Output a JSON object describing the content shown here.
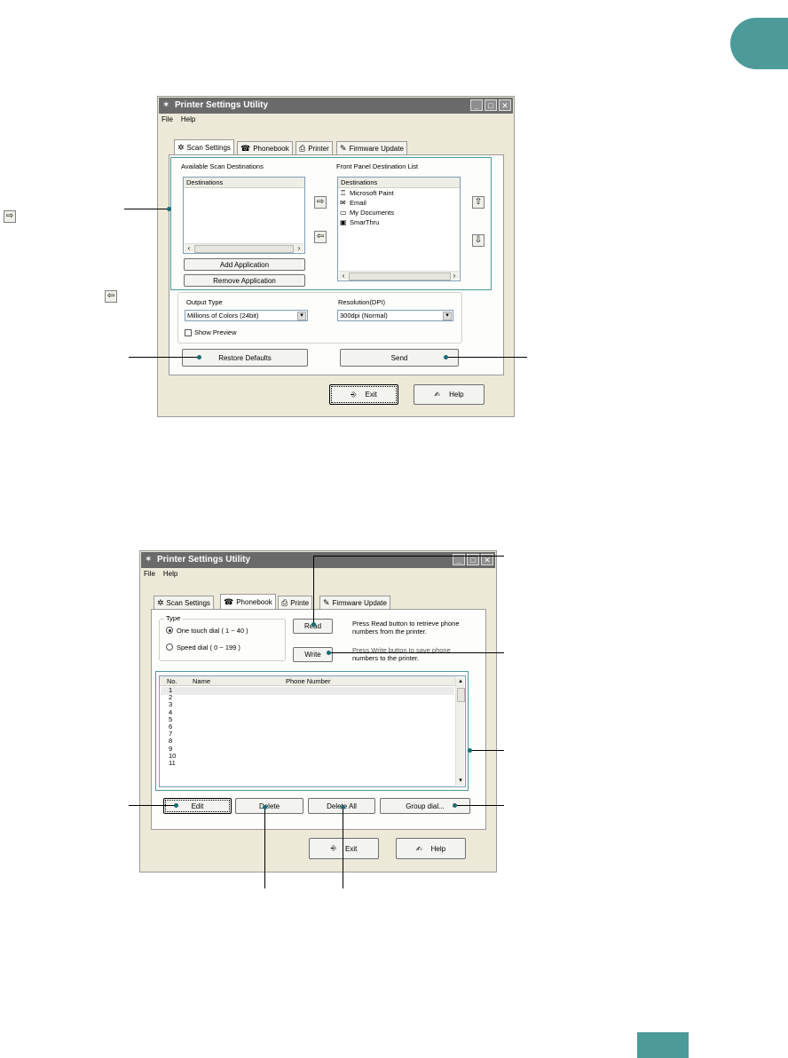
{
  "colors": {
    "accent": "#4d9a9b",
    "callout_dot": "#1a6b74"
  },
  "window1": {
    "title": "Printer Settings Utility",
    "menu": [
      "File",
      "Help"
    ],
    "tabs": [
      {
        "label": "Scan Settings",
        "icon": "scanner-icon"
      },
      {
        "label": "Phonebook",
        "icon": "phonebook-icon"
      },
      {
        "label": "Printer",
        "icon": "printer-icon"
      },
      {
        "label": "Firmware Update",
        "icon": "firmware-icon"
      }
    ],
    "available_label": "Available Scan Destinations",
    "front_panel_label": "Front Panel Destination List",
    "destinations_header": "Destinations",
    "front_panel_items": [
      {
        "label": "Microsoft Paint",
        "icon": "paint-icon"
      },
      {
        "label": "Email",
        "icon": "email-icon"
      },
      {
        "label": "My Documents",
        "icon": "folder-icon"
      },
      {
        "label": "SmarThru",
        "icon": "smarthru-icon"
      }
    ],
    "add_application": "Add Application",
    "remove_application": "Remove Application",
    "output_type_label": "Output Type",
    "output_type_value": "Millions of Colors (24bit)",
    "resolution_label": "Resolution(DPI)",
    "resolution_value": "300dpi (Normal)",
    "show_preview": "Show Preview",
    "restore_defaults": "Restore Defaults",
    "send": "Send",
    "exit": "Exit",
    "help": "Help"
  },
  "window2": {
    "title": "Printer Settings Utility",
    "menu": [
      "File",
      "Help"
    ],
    "tabs": [
      {
        "label": "Scan Settings",
        "icon": "scanner-icon"
      },
      {
        "label": "Phonebook",
        "icon": "phonebook-icon"
      },
      {
        "label": "Printe",
        "icon": "printer-icon"
      },
      {
        "label": "Firmware Update",
        "icon": "firmware-icon"
      }
    ],
    "type_label": "Type",
    "one_touch": "One touch dial ( 1 ~ 40 )",
    "speed_dial": "Speed dial ( 0 ~ 199 )",
    "read": "Read",
    "read_desc_line1": "Press Read button to retrieve phone",
    "read_desc_line2": "numbers from the printer.",
    "write": "Write",
    "write_desc_line1": "Press Write button to save phone",
    "write_desc_line2": "numbers to the printer.",
    "table_headers": [
      "No.",
      "Name",
      "Phone Number"
    ],
    "rows": [
      "1",
      "2",
      "3",
      "4",
      "5",
      "6",
      "7",
      "8",
      "9",
      "10",
      "11"
    ],
    "edit": "Edit",
    "delete": "Delete",
    "delete_all": "Delete All",
    "group_dial": "Group dial...",
    "exit": "Exit",
    "help": "Help"
  }
}
